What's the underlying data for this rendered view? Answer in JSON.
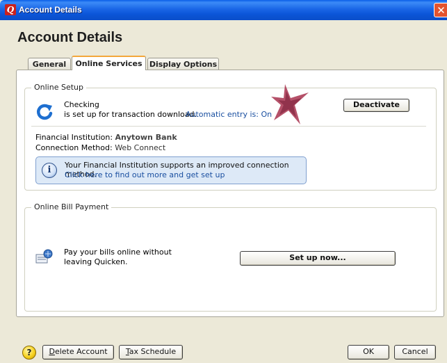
{
  "window": {
    "title": "Account Details",
    "close_glyph": "✕",
    "app_icon_letter": "Q"
  },
  "heading": "Account Details",
  "tabs": [
    {
      "label": "General",
      "selected": false
    },
    {
      "label": "Online Services",
      "selected": true
    },
    {
      "label": "Display Options",
      "selected": false
    }
  ],
  "online_setup": {
    "group_label": "Online Setup",
    "account_name": "Checking",
    "download_status": "is set up for transaction download.",
    "auto_entry": "Automatic entry is: On",
    "deactivate_label": "Deactivate",
    "financial_institution_label": "Financial Institution:",
    "financial_institution_value": "Anytown Bank",
    "connection_method_label": "Connection Method:",
    "connection_method_value": "Web Connect",
    "info_message": "Your Financial Institution supports an improved connection method.",
    "info_link": "Click here to find out more and get set up",
    "info_icon_glyph": "i"
  },
  "bill_payment": {
    "group_label": "Online Bill Payment",
    "line1": "Pay your bills online without",
    "line2": "leaving Quicken.",
    "setup_label": "Set up now..."
  },
  "footer": {
    "help_glyph": "?",
    "delete_underline": "D",
    "delete_rest": "elete Account",
    "tax_underline": "T",
    "tax_rest": "ax Schedule",
    "ok_label": "OK",
    "cancel_label": "Cancel"
  },
  "icons": {
    "refresh": "refresh-icon",
    "info": "info-icon",
    "bill": "bill-payment-icon",
    "help": "help-icon",
    "star": "star-decoration"
  },
  "colors": {
    "titlebar": "#0a5ee8",
    "link": "#1a4fa0",
    "info_bg": "#dde9f7",
    "tab_highlight": "#f3a73a",
    "star": "#b0304e"
  }
}
